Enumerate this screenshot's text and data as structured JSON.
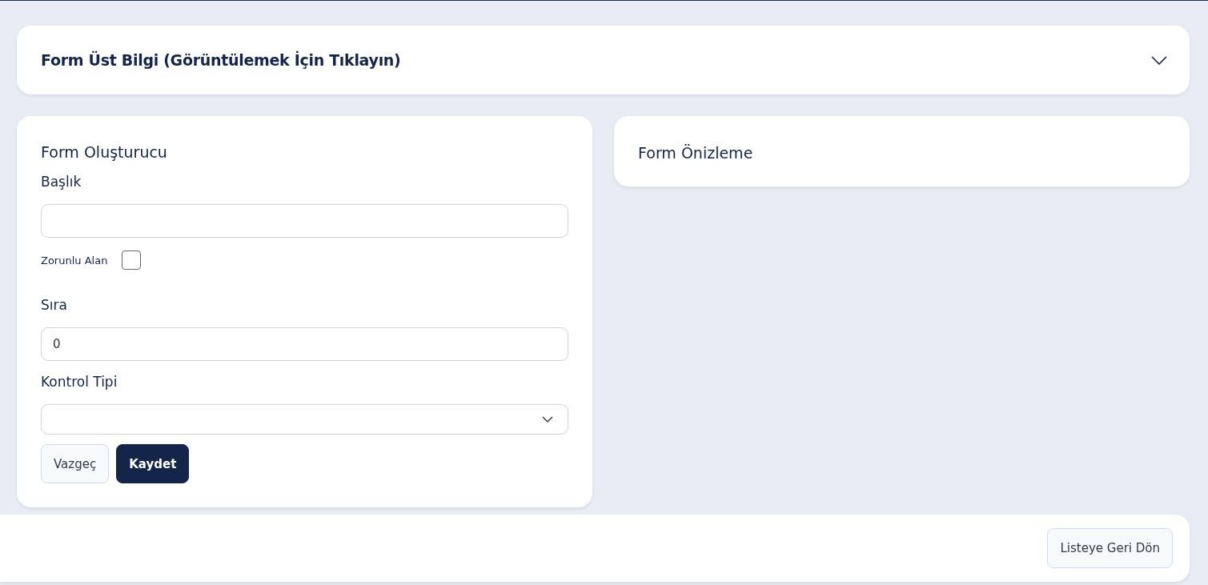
{
  "header_panel": {
    "title": "Form Üst Bilgi (Görüntülemek İçin Tıklayın)",
    "expanded": false
  },
  "form_builder": {
    "title": "Form Oluşturucu",
    "fields": [
      {
        "kind": "text",
        "label": "Başlık"
      },
      {
        "kind": "checkbox",
        "label": "Zorunlu Alan",
        "checked": false
      },
      {
        "kind": "text",
        "label": "Sıra",
        "value": "0"
      },
      {
        "kind": "select",
        "label": "Kontrol Tipi"
      }
    ],
    "buttons": [
      {
        "label": "Vazgeç",
        "kind": "secondary"
      },
      {
        "label": "Kaydet",
        "kind": "primary"
      }
    ]
  },
  "form_preview": {
    "title": "Form Önizleme"
  },
  "footer": {
    "buttons": [
      {
        "label": "Listeye Geri Dön",
        "kind": "secondary"
      }
    ]
  }
}
